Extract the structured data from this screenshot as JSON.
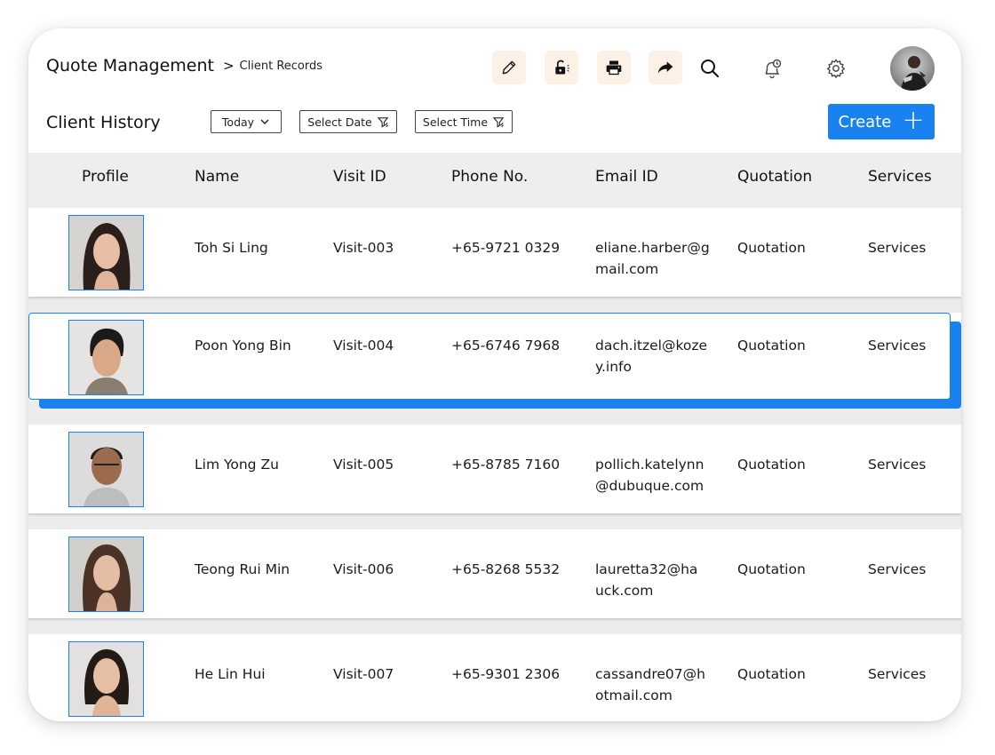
{
  "header": {
    "title": "Quote Management",
    "breadcrumb_sep": ">",
    "breadcrumb": "Client Records"
  },
  "toolbar": {
    "icons": [
      "edit-icon",
      "unlock-icon",
      "print-icon",
      "share-icon",
      "search-icon",
      "bell-icon",
      "gear-icon"
    ]
  },
  "section": {
    "title": "Client History",
    "filters": {
      "today": "Today",
      "date": "Select Date",
      "time": "Select Time"
    },
    "create_label": "Create"
  },
  "columns": {
    "profile": "Profile",
    "name": "Name",
    "visit": "Visit ID",
    "phone": "Phone No.",
    "email": "Email ID",
    "quotation": "Quotation",
    "services": "Services"
  },
  "rows": [
    {
      "name": "Toh Si Ling",
      "visit": "Visit-003",
      "phone": "+65-9721 0329",
      "email": "eliane.harber@gmail.com",
      "quotation": "Quotation",
      "services": "Services"
    },
    {
      "name": "Poon Yong Bin",
      "visit": "Visit-004",
      "phone": "+65-6746 7968",
      "email": "dach.itzel@kozey.info",
      "quotation": "Quotation",
      "services": "Services"
    },
    {
      "name": "Lim Yong Zu",
      "visit": "Visit-005",
      "phone": "+65-8785 7160",
      "email": "pollich.katelynn@dubuque.com",
      "quotation": "Quotation",
      "services": "Services"
    },
    {
      "name": "Teong Rui Min",
      "visit": "Visit-006",
      "phone": "+65-8268 5532",
      "email": "lauretta32@hauck.com",
      "quotation": "Quotation",
      "services": "Services"
    },
    {
      "name": "He Lin Hui",
      "visit": "Visit-007",
      "phone": "+65-9301 2306",
      "email": "cassandre07@hotmail.com",
      "quotation": "Quotation",
      "services": "Services"
    }
  ],
  "selected_row": 1,
  "colors": {
    "accent": "#1a82f0",
    "icon_bg": "#fdf1e6",
    "header_bg": "#eeeeee"
  }
}
